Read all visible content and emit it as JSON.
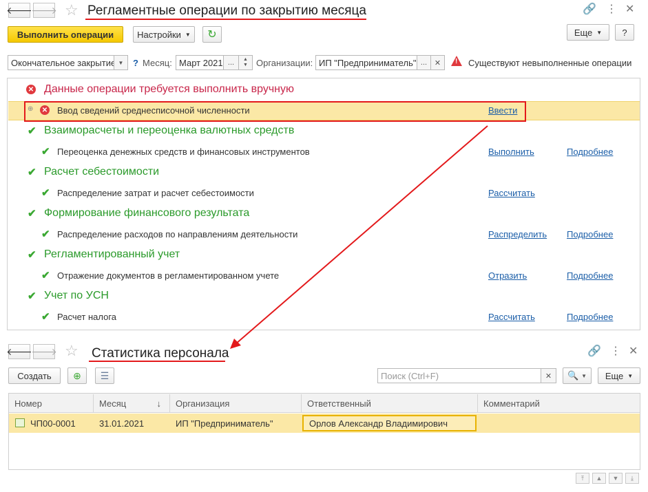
{
  "top_form": {
    "title": "Регламентные операции по закрытию месяца",
    "run_button": "Выполнить операции",
    "settings_button": "Настройки",
    "more_button": "Еще",
    "help_button": "?",
    "mode_value": "Окончательное закрытие",
    "help_mark": "?",
    "month_label": "Месяц:",
    "month_value": "Март 2021",
    "org_label": "Организации:",
    "org_value": "ИП \"Предприниматель\"",
    "warning_text": "Существуют невыполненные операции",
    "groups": [
      {
        "title": "Данные операции требуется выполнить вручную",
        "status": "error",
        "items": [
          {
            "text": "Ввод сведений среднесписочной численности",
            "action": "Ввести",
            "details": ""
          }
        ]
      },
      {
        "title": "Взаиморасчеты и переоценка валютных средств",
        "status": "ok",
        "items": [
          {
            "text": "Переоценка денежных средств и финансовых инструментов",
            "action": "Выполнить",
            "details": "Подробнее"
          }
        ]
      },
      {
        "title": "Расчет себестоимости",
        "status": "ok",
        "items": [
          {
            "text": "Распределение затрат и расчет себестоимости",
            "action": "Рассчитать",
            "details": ""
          }
        ]
      },
      {
        "title": "Формирование финансового результата",
        "status": "ok",
        "items": [
          {
            "text": "Распределение расходов по направлениям деятельности",
            "action": "Распределить",
            "details": "Подробнее"
          }
        ]
      },
      {
        "title": "Регламентированный учет",
        "status": "ok",
        "items": [
          {
            "text": "Отражение документов в регламентированном учете",
            "action": "Отразить",
            "details": "Подробнее"
          }
        ]
      },
      {
        "title": "Учет по УСН",
        "status": "ok",
        "items": [
          {
            "text": "Расчет налога",
            "action": "Рассчитать",
            "details": "Подробнее"
          }
        ]
      }
    ]
  },
  "bottom_form": {
    "title": "Статистика персонала",
    "create_button": "Создать",
    "search_placeholder": "Поиск (Ctrl+F)",
    "more_button": "Еще",
    "columns": [
      "Номер",
      "Месяц",
      "Организация",
      "Ответственный",
      "Комментарий"
    ],
    "sort_indicator": "↓",
    "rows": [
      {
        "number": "ЧП00-0001",
        "month": "31.01.2021",
        "org": "ИП \"Предприниматель\"",
        "responsible": "Орлов Александр Владимирович",
        "comment": ""
      }
    ]
  },
  "colors": {
    "accent_yellow": "#f5c800",
    "error_red": "#e0393e",
    "ok_green": "#3aa832",
    "link_blue": "#1b5ea8",
    "highlight_row": "#fbe8a6"
  }
}
